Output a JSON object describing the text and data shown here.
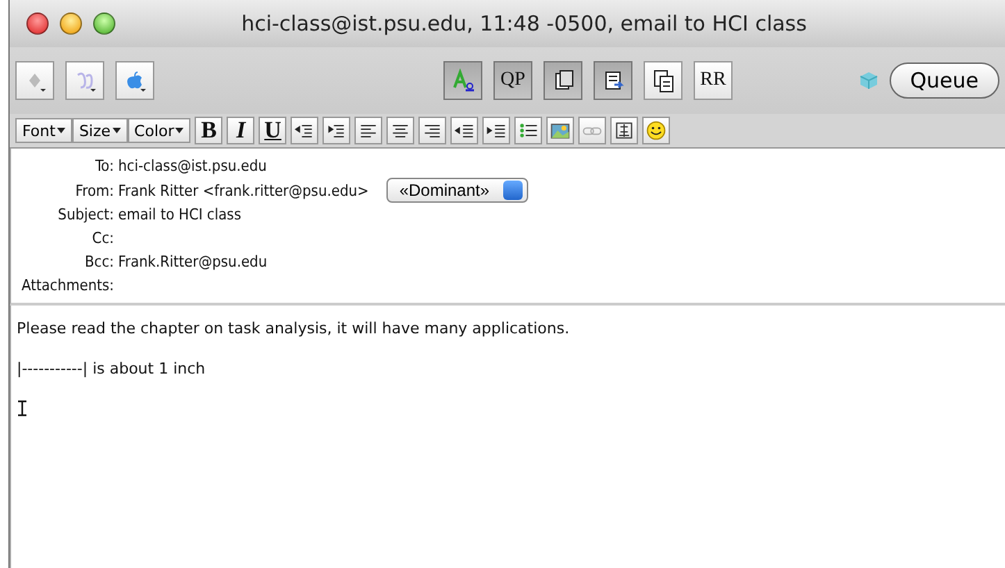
{
  "window": {
    "title": "hci-class@ist.psu.edu, 11:48 -0500, email to HCI class"
  },
  "toolbar": {
    "center_buttons": [
      {
        "kind": "icon",
        "pressed": true
      },
      {
        "kind": "text",
        "label": "QP",
        "pressed": true
      },
      {
        "kind": "icon",
        "pressed": true
      },
      {
        "kind": "icon",
        "pressed": true
      },
      {
        "kind": "icon",
        "pressed": false
      },
      {
        "kind": "text",
        "label": "RR",
        "pressed": false
      }
    ],
    "queue_button": "Queue"
  },
  "format_bar": {
    "menus": [
      "Font",
      "Size",
      "Color"
    ],
    "buttons": [
      {
        "kind": "text",
        "label": "B"
      },
      {
        "kind": "text",
        "label": "I"
      },
      {
        "kind": "text",
        "label": "U"
      },
      {
        "kind": "icon"
      },
      {
        "kind": "icon"
      },
      {
        "kind": "icon"
      },
      {
        "kind": "icon"
      },
      {
        "kind": "icon"
      },
      {
        "kind": "icon"
      },
      {
        "kind": "icon"
      },
      {
        "kind": "icon"
      },
      {
        "kind": "icon"
      },
      {
        "kind": "icon"
      },
      {
        "kind": "icon"
      },
      {
        "kind": "icon"
      }
    ]
  },
  "headers": [
    {
      "label": "To:",
      "value": "hci-class@ist.psu.edu"
    },
    {
      "label": "From:",
      "value": "Frank Ritter <frank.ritter@psu.edu>",
      "popup": "«Dominant»"
    },
    {
      "label": "Subject:",
      "value": "email to HCI class"
    },
    {
      "label": "Cc:"
    },
    {
      "label": "Bcc:",
      "value": "Frank.Ritter@psu.edu"
    },
    {
      "label": "Attachments:"
    }
  ],
  "body": {
    "lines": [
      "Please read the chapter on task analysis, it will have many applications.",
      "|-----------| is about 1 inch"
    ]
  }
}
